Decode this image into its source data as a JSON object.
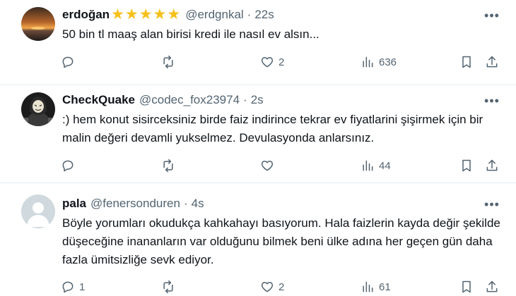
{
  "tweets": [
    {
      "name": "erdoğan",
      "handle": "@erdgnkal",
      "dot": "·",
      "time": "22s",
      "text": "50 bin tl maaş alan birisi kredi ile nasıl ev alsın...",
      "reply_count": "",
      "retweet_count": "",
      "like_count": "2",
      "view_count": "636",
      "stars": 5,
      "avatar_icon": "sunset-avatar"
    },
    {
      "name": "CheckQuake",
      "handle": "@codec_fox23974",
      "dot": "·",
      "time": "2s",
      "text": ":) hem konut sisirceksiniz birde faiz indirince tekrar ev fiyatlarini şişirmek için bir malin değeri devamli yukselmez. Devulasyonda anlarsınız.",
      "reply_count": "",
      "retweet_count": "",
      "like_count": "",
      "view_count": "44",
      "avatar_icon": "hacker-mask-avatar"
    },
    {
      "name": "pala",
      "handle": "@fenersonduren",
      "dot": "·",
      "time": "4s",
      "text": "Böyle yorumları okudukça kahkahayı basıyorum. Hala faizlerin kayda değir şekilde düşeceğine inananların var olduğunu bilmek beni ülke adına her geçen gün daha fazla ümitsizliğe sevk ediyor.",
      "reply_count": "1",
      "retweet_count": "",
      "like_count": "2",
      "view_count": "61",
      "avatar_icon": "default-user-avatar"
    }
  ],
  "colors": {
    "text": "#0f1419",
    "muted": "#536471",
    "star": "#f6c018",
    "divider": "#e6ecf0"
  },
  "more_icon": "more-icon"
}
